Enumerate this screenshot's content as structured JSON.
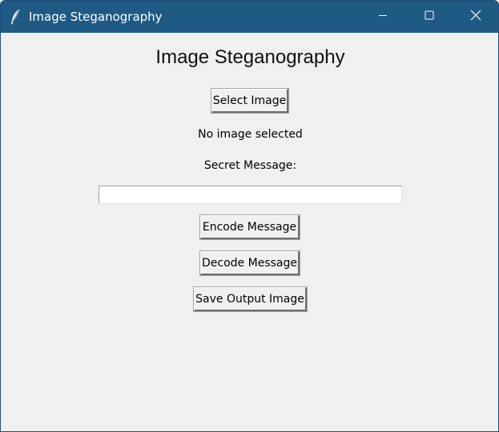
{
  "window": {
    "title": "Image Steganography",
    "icon": "feather-icon",
    "titlebar_color": "#1f5a84",
    "controls": {
      "minimize": "minimize-icon",
      "maximize": "maximize-icon",
      "close": "close-icon"
    }
  },
  "main": {
    "heading": "Image Steganography",
    "select_button_label": "Select Image",
    "image_status": "No image selected",
    "message_label": "Secret Message:",
    "message_value": "",
    "encode_button_label": "Encode Message",
    "decode_button_label": "Decode Message",
    "save_button_label": "Save Output Image"
  }
}
